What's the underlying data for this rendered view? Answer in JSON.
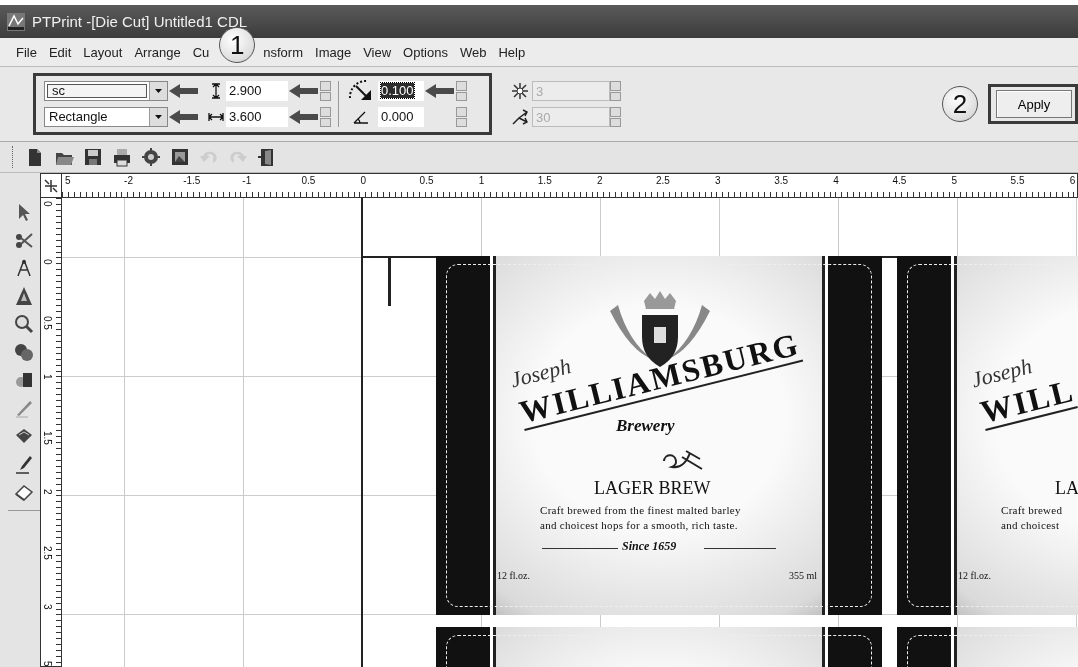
{
  "window": {
    "title": "PTPrint -[Die Cut] Untitled1 CDL"
  },
  "menu": [
    {
      "label": "File"
    },
    {
      "label": "Edit"
    },
    {
      "label": "Layout"
    },
    {
      "label": "Arrange"
    },
    {
      "kind": "item",
      "label": "Cu"
    },
    {
      "kind": "callout",
      "label": "1"
    },
    {
      "kind": "item",
      "label": "nsform"
    },
    {
      "label": "Image"
    },
    {
      "label": "View"
    },
    {
      "label": "Options"
    },
    {
      "label": "Web"
    },
    {
      "label": "Help"
    }
  ],
  "property_bar": {
    "shape_style": {
      "value": "sc"
    },
    "shape_type": {
      "value": "Rectangle"
    },
    "height": {
      "value": "2.900"
    },
    "width": {
      "value": "3.600"
    },
    "corner_radius": {
      "value": "0.100",
      "selected": true
    },
    "angle": {
      "value": "0.000"
    },
    "points": {
      "value": "3",
      "disabled": true
    },
    "inset": {
      "value": "30",
      "disabled": true
    },
    "callout": "2",
    "apply_button": "Apply"
  },
  "toolbar": [
    {
      "kind": "new",
      "disabled": false
    },
    {
      "kind": "open",
      "disabled": false
    },
    {
      "kind": "save",
      "disabled": false
    },
    {
      "kind": "print",
      "disabled": false
    },
    {
      "kind": "cut",
      "disabled": false
    },
    {
      "kind": "image",
      "disabled": false
    },
    {
      "kind": "undo",
      "disabled": true
    },
    {
      "kind": "redo",
      "disabled": true
    },
    {
      "kind": "exit",
      "disabled": false
    }
  ],
  "toolbox": [
    {
      "kind": "pointer"
    },
    {
      "kind": "scissors"
    },
    {
      "kind": "compass"
    },
    {
      "kind": "text"
    },
    {
      "kind": "zoom"
    },
    {
      "kind": "circles"
    },
    {
      "kind": "shapes"
    },
    {
      "kind": "pencil"
    },
    {
      "kind": "fill"
    },
    {
      "kind": "pen"
    },
    {
      "kind": "eraser"
    }
  ],
  "ruler": {
    "horizontal": [
      "5",
      "-2",
      "-1.5",
      "-1",
      "0.5",
      "0",
      "0.5",
      "1",
      "1.5",
      "2",
      "2.5",
      "3",
      "3.5",
      "4",
      "4.5",
      "5",
      "5.5",
      "6"
    ],
    "vertical": [
      "0",
      "0",
      "0.5",
      "1",
      "1.5",
      "2",
      "2.5",
      "3",
      "5"
    ]
  },
  "canvas": {
    "labels": [
      {
        "crest": true,
        "flourish": true,
        "texts": [
          {
            "kind": "script",
            "text": "Joseph"
          },
          {
            "kind": "title",
            "text": "WILLIAMSBURG"
          },
          {
            "kind": "sub",
            "text": "Brewery"
          },
          {
            "kind": "heading",
            "text": "LAGER BREW"
          },
          {
            "kind": "desc1",
            "text": "Craft brewed from the finest malted barley"
          },
          {
            "kind": "desc2",
            "text": "and choicest hops for a smooth, rich taste."
          },
          {
            "kind": "since",
            "text": "Since 1659"
          },
          {
            "kind": "left",
            "text": "12 fl.oz."
          },
          {
            "kind": "right",
            "text": "355 ml"
          }
        ]
      },
      {
        "crest": false,
        "flourish": false,
        "texts": [
          {
            "kind": "script",
            "text": "Joseph"
          },
          {
            "kind": "title",
            "text": "WILL"
          },
          {
            "kind": "heading",
            "text": "LA"
          },
          {
            "kind": "desc1",
            "text": "Craft brewed"
          },
          {
            "kind": "desc2",
            "text": "and choicest"
          },
          {
            "kind": "left",
            "text": "12 fl.oz."
          }
        ]
      },
      {
        "crest": false,
        "flourish": false
      },
      {
        "crest": false,
        "flourish": false
      }
    ]
  }
}
